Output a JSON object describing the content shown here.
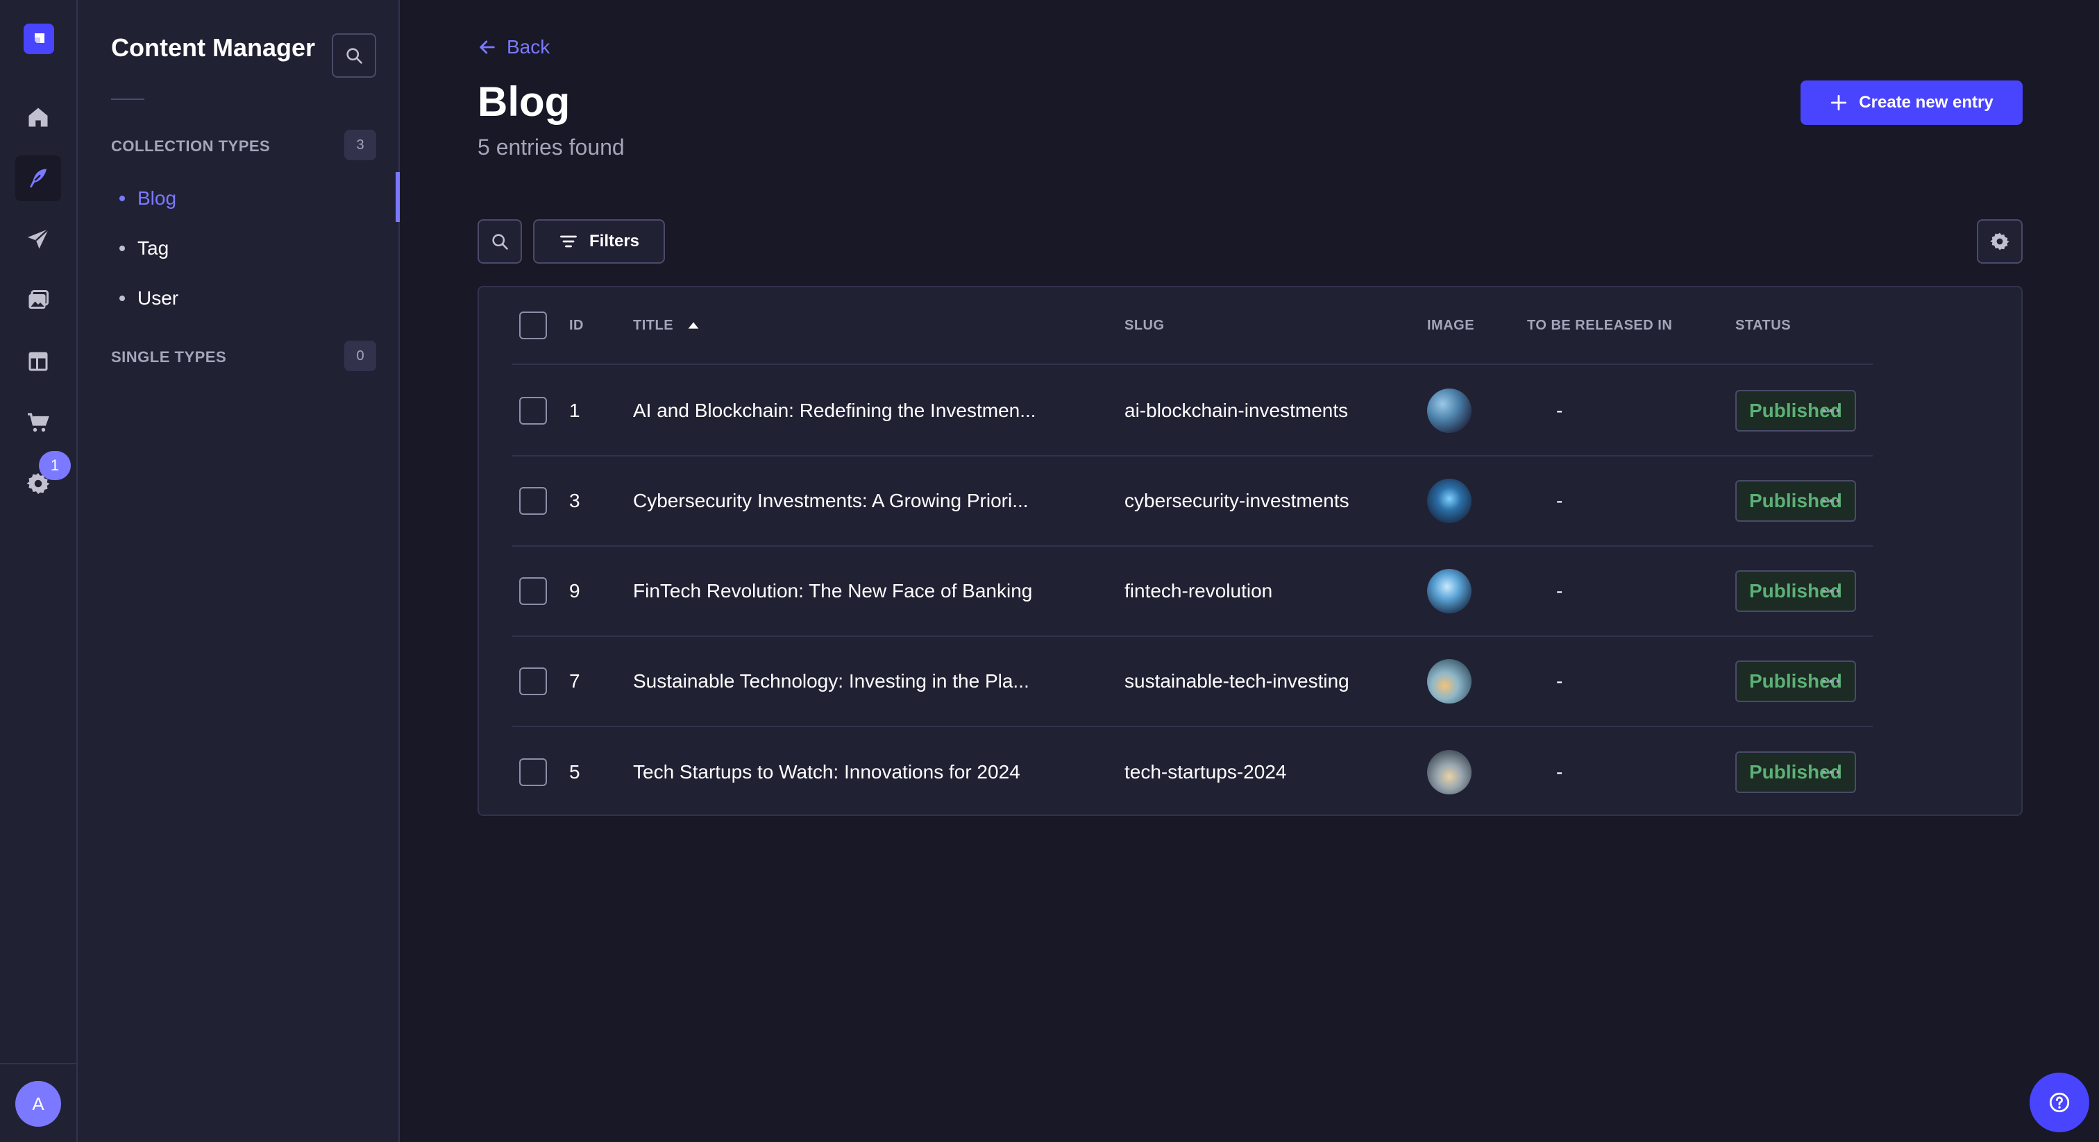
{
  "colors": {
    "accent": "#4945ff",
    "accent_light": "#7b79ff",
    "published": "#5cb176",
    "background": "#181826",
    "panel": "#212134"
  },
  "rail": {
    "items": [
      {
        "icon": "home-icon"
      },
      {
        "icon": "content-manager-feather-icon",
        "active": true
      },
      {
        "icon": "paper-plane-icon"
      },
      {
        "icon": "media-library-icon"
      },
      {
        "icon": "layout-icon"
      },
      {
        "icon": "cart-icon"
      },
      {
        "icon": "gear-icon"
      }
    ],
    "settings_badge": "1",
    "avatar_initial": "A"
  },
  "subnav": {
    "title": "Content Manager",
    "collection_types": {
      "label": "COLLECTION TYPES",
      "count": "3",
      "items": [
        "Blog",
        "Tag",
        "User"
      ]
    },
    "single_types": {
      "label": "SINGLE TYPES",
      "count": "0"
    }
  },
  "main": {
    "back_label": "Back",
    "title": "Blog",
    "subtitle": "5 entries found",
    "create_label": "Create new entry",
    "filters_label": "Filters"
  },
  "table": {
    "headers": {
      "id": "ID",
      "title": "TITLE",
      "slug": "SLUG",
      "image": "IMAGE",
      "release": "TO BE RELEASED IN",
      "status": "STATUS"
    },
    "rows": [
      {
        "id": "1",
        "title": "AI and Blockchain: Redefining the Investmen...",
        "slug": "ai-blockchain-investments",
        "release": "-",
        "status": "Published"
      },
      {
        "id": "3",
        "title": "Cybersecurity Investments: A Growing Priori...",
        "slug": "cybersecurity-investments",
        "release": "-",
        "status": "Published"
      },
      {
        "id": "9",
        "title": "FinTech Revolution: The New Face of Banking",
        "slug": "fintech-revolution",
        "release": "-",
        "status": "Published"
      },
      {
        "id": "7",
        "title": "Sustainable Technology: Investing in the Pla...",
        "slug": "sustainable-tech-investing",
        "release": "-",
        "status": "Published"
      },
      {
        "id": "5",
        "title": "Tech Startups to Watch: Innovations for 2024",
        "slug": "tech-startups-2024",
        "release": "-",
        "status": "Published"
      }
    ]
  }
}
